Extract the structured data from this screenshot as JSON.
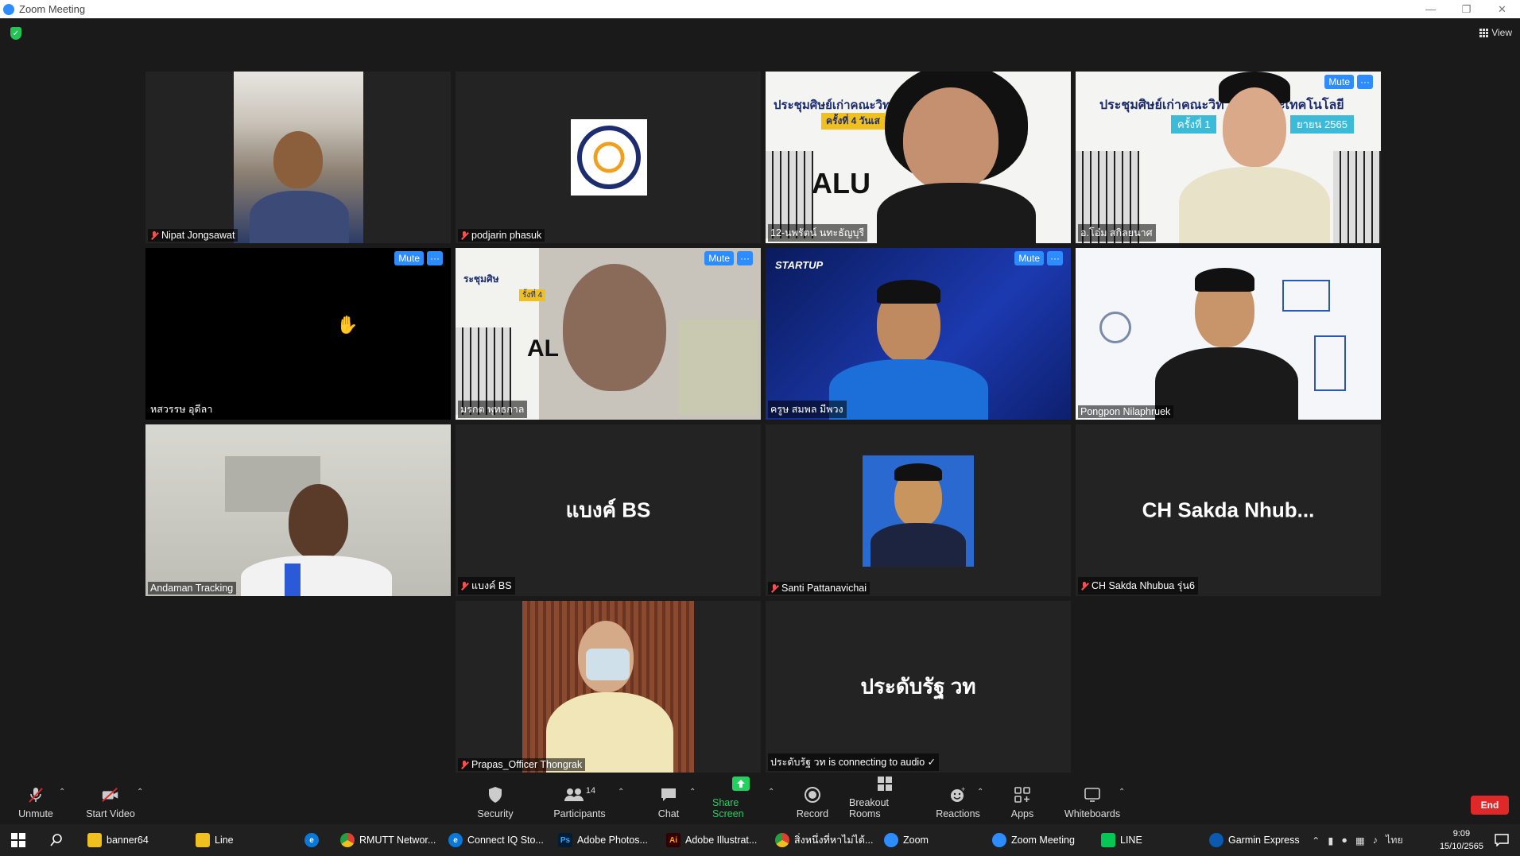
{
  "window": {
    "title": "Zoom Meeting"
  },
  "header": {
    "view_label": "View"
  },
  "tiles": [
    {
      "name": "Nipat Jongsawat",
      "muted": true
    },
    {
      "name": "podjarin phasuk",
      "muted": true
    },
    {
      "name": "12-นพรัตน์ นทะธัญบุรี",
      "muted": false
    },
    {
      "name": "อ.โอ๋ม สกิลยนาศ",
      "muted": false,
      "mute_label": "Mute",
      "more_label": "···"
    },
    {
      "name": "หสวรรษ อุดีลา",
      "muted": false,
      "mute_label": "Mute",
      "more_label": "···"
    },
    {
      "name": "มรกต พุทธกาล",
      "muted": false,
      "mute_label": "Mute",
      "more_label": "···"
    },
    {
      "name": "ครูษ สมพล มีพวง",
      "muted": false,
      "mute_label": "Mute",
      "more_label": "···"
    },
    {
      "name": "Pongpon Nilaphruek",
      "muted": false
    },
    {
      "name": "Andaman Tracking",
      "muted": false
    },
    {
      "name": "แบงค์ BS",
      "muted": true,
      "big_name": "แบงค์ BS"
    },
    {
      "name": "Santi Pattanavichai",
      "muted": true
    },
    {
      "name": "CH Sakda Nhubua รุ่น6",
      "muted": true,
      "big_name": "CH Sakda Nhub..."
    },
    {
      "name": "Prapas_Officer Thongrak",
      "muted": true
    },
    {
      "name": "ประดับรัฐ วท is connecting to audio ✓",
      "muted": false,
      "big_name": "ประดับรัฐ วท"
    }
  ],
  "video_text": {
    "banner1": "ประชุมศิษย์เก่าคณะวิทยาศ",
    "banner1_sub": "ครั้งที่ 4 วันเส",
    "banner2": "ประชุมศิษย์เก่าคณะวิท",
    "banner2_tail": "ะเทคโนโลยี",
    "banner2_sub": "ครั้งที่ 1",
    "banner2_year": "ยายน 2565",
    "alu": "ALU",
    "alu2": "AL",
    "startup": "STARTUP",
    "banner3": "ระชุมศิษ",
    "banner3_sub": "รั้งที่ 4"
  },
  "toolbar": {
    "unmute": "Unmute",
    "start_video": "Start Video",
    "security": "Security",
    "participants": "Participants",
    "participants_count": "14",
    "chat": "Chat",
    "share_screen": "Share Screen",
    "record": "Record",
    "breakout_rooms": "Breakout Rooms",
    "reactions": "Reactions",
    "apps": "Apps",
    "whiteboards": "Whiteboards",
    "end": "End"
  },
  "taskbar": {
    "items": [
      "banner64",
      "Line",
      "RMUTT Networ...",
      "Connect IQ Sto...",
      "Adobe Photos...",
      "Adobe Illustrat...",
      "สิ่งหนึ่งที่หาไม่ได้...",
      "Zoom",
      "Zoom Meeting",
      "LINE",
      "Garmin Express"
    ],
    "lang": "ไทย",
    "time": "9:09",
    "date": "15/10/2565"
  },
  "colors": {
    "accent": "#2D8CFF",
    "active_speaker": "#e9f63b",
    "end": "#e02828",
    "share": "#23d160"
  }
}
